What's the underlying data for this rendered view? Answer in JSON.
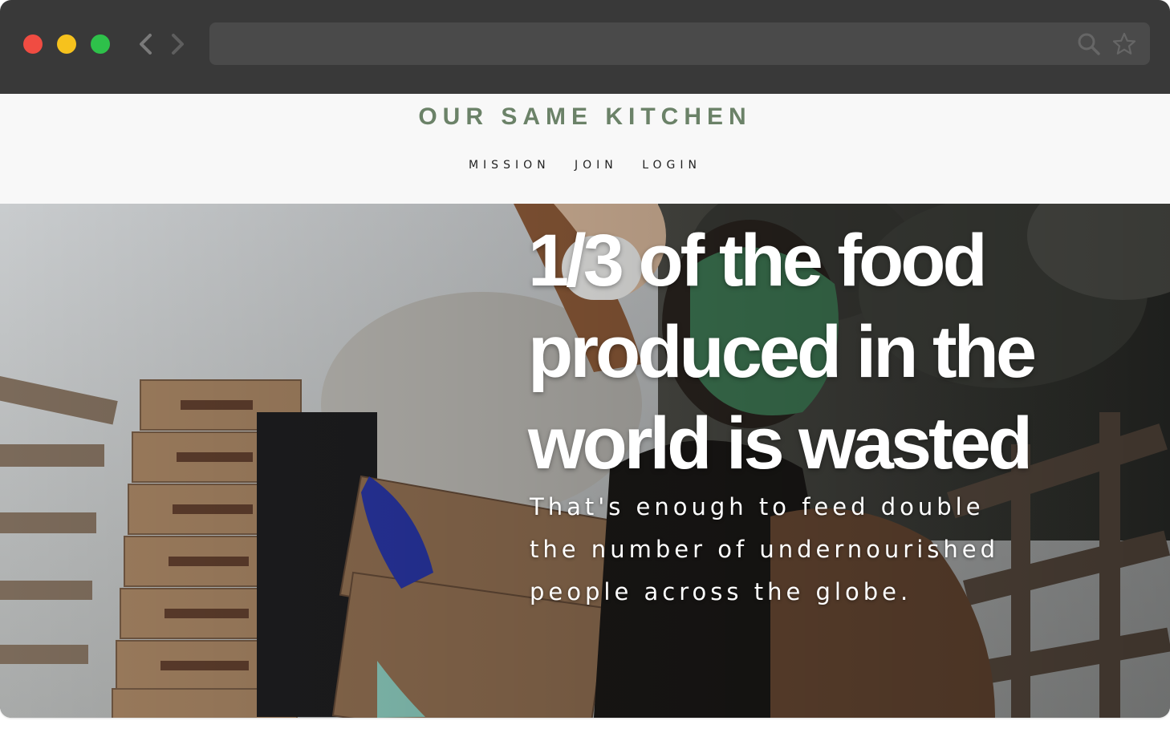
{
  "browser": {
    "traffic_lights": [
      "close",
      "minimize",
      "zoom"
    ],
    "address_value": "",
    "icons": [
      "back-arrow-icon",
      "forward-arrow-icon",
      "search-icon",
      "star-icon"
    ]
  },
  "site": {
    "brand": "OUR SAME KITCHEN",
    "brand_color": "#6b8268",
    "nav": [
      {
        "label": "MISSION"
      },
      {
        "label": "JOIN"
      },
      {
        "label": "LOGIN"
      }
    ]
  },
  "hero": {
    "headline": "1/3 of the food produced in the world is wasted",
    "subtext": "That's enough to feed double the number of undernourished people across the globe."
  }
}
